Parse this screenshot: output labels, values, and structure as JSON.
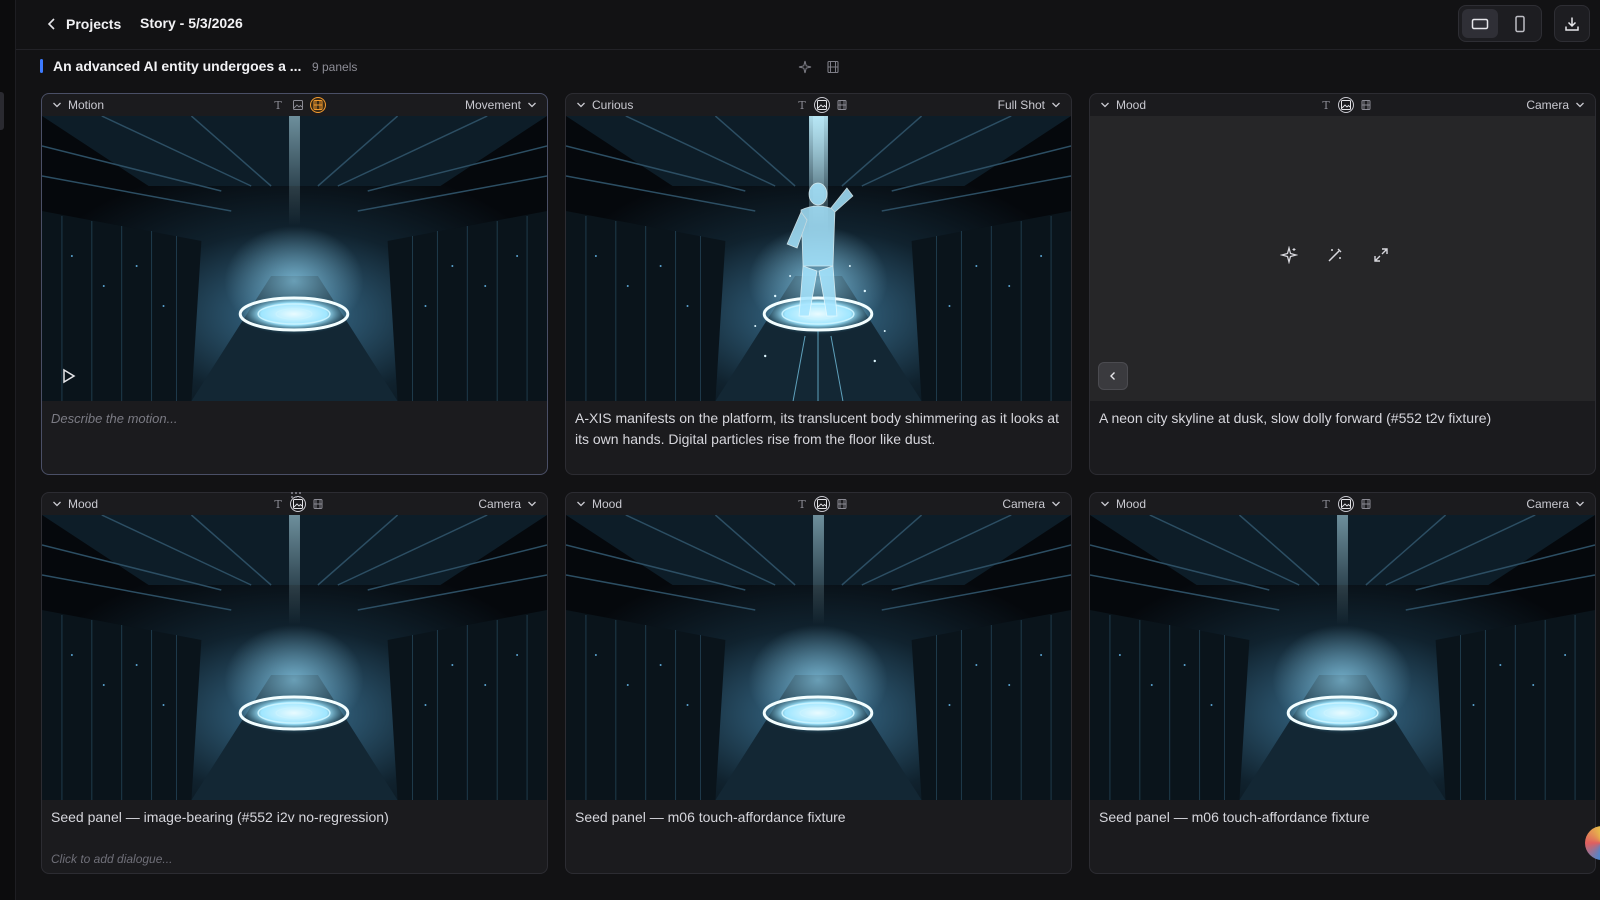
{
  "topbar": {
    "back_label": "Projects",
    "story_title": "Story - 5/3/2026",
    "view_modes": [
      "landscape-icon",
      "portrait-icon"
    ],
    "active_view": "landscape"
  },
  "scene": {
    "title": "An advanced AI entity undergoes a ...",
    "panel_count": "9 panels",
    "accent_color": "#3d7bff"
  },
  "panels": [
    {
      "category": "Motion",
      "right_label": "Movement",
      "mode_active": "video",
      "has_image": true,
      "has_figure": false,
      "show_play": true,
      "description": "",
      "placeholder": "Describe the motion...",
      "dialogue": ""
    },
    {
      "category": "Curious",
      "right_label": "Full Shot",
      "mode_active": "image",
      "has_image": true,
      "has_figure": true,
      "description": "A-XIS manifests on the platform, its translucent body shimmering as it looks at its own hands. Digital particles rise from the floor like dust.",
      "dialogue": ""
    },
    {
      "category": "Mood",
      "right_label": "Camera",
      "mode_active": "image",
      "has_image": false,
      "description": "A neon city skyline at dusk, slow dolly forward (#552 t2v fixture)",
      "dialogue": ""
    },
    {
      "category": "Mood",
      "right_label": "Camera",
      "mode_active": "image",
      "has_image": true,
      "has_figure": false,
      "description": "Seed panel — image-bearing (#552 i2v no-regression)",
      "dialogue": "Click to add dialogue..."
    },
    {
      "category": "Mood",
      "right_label": "Camera",
      "mode_active": "image",
      "has_image": true,
      "has_figure": false,
      "description": "Seed panel — m06 touch-affordance fixture",
      "dialogue": ""
    },
    {
      "category": "Mood",
      "right_label": "Camera",
      "mode_active": "image",
      "has_image": true,
      "has_figure": false,
      "description": "Seed panel — m06 touch-affordance fixture",
      "dialogue": ""
    }
  ],
  "mode_icons": [
    "text-icon",
    "image-icon",
    "video-icon"
  ],
  "colors": {
    "video_active": "#f29a2e",
    "glow": "#9fe6ff"
  }
}
